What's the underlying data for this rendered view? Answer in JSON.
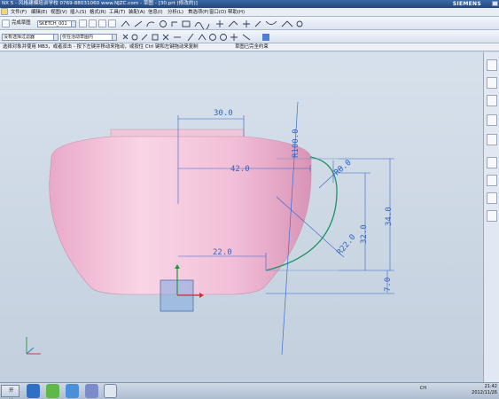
{
  "window": {
    "title": "NX 5 - 风格建模培训学校  0769-88031060  www.NJZC.com - 草图 - [30.prt (修改的)]",
    "brand": "SIEMENS"
  },
  "menu": [
    "文件(F)",
    "编辑(E)",
    "视图(V)",
    "插入(S)",
    "格式(R)",
    "工具(T)",
    "装配(A)",
    "信息(I)",
    "分析(L)",
    "首选项(P)",
    "窗口(O)",
    "帮助(H)"
  ],
  "toolbar": {
    "finish_sketch": "完成草图",
    "sketch_name": "SKETCH_001",
    "filter": "没有选择过滤器",
    "scope": "仅在活动草图内"
  },
  "cue_line": {
    "prompt": "选择对象并使用 MB3，或者双击 - 按下左键并移动来拖动，或按住 Ctrl 键和左键拖动来复制",
    "status": "草图已完全约束"
  },
  "dimensions": {
    "d1": "30.0",
    "d2": "R100.0",
    "d3": "42.0",
    "d4": "R8.0",
    "d5": "34.0",
    "d6": "32.0",
    "d7": "R22.0",
    "d8": "22.0",
    "d9": "7.0"
  },
  "colors": {
    "cup": "#f2bfd8",
    "dimension": "#2f66c8",
    "sketch_curve": "#1e9460",
    "background": "#cfdbe8"
  },
  "taskbar": {
    "start": "开始",
    "time": "21:42",
    "date": "2012/11/26",
    "lang": "CH"
  }
}
